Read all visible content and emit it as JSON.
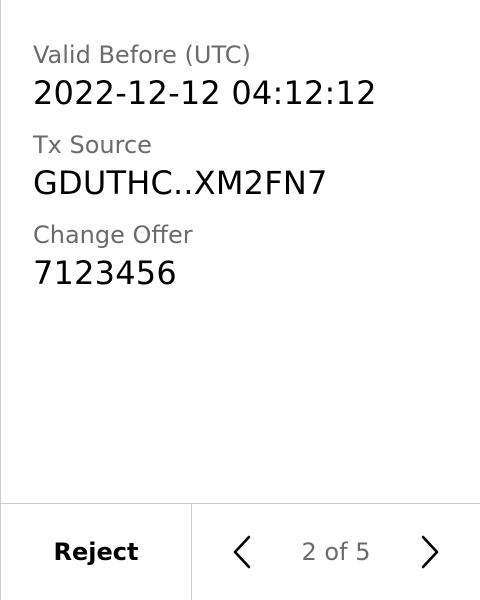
{
  "fields": [
    {
      "label": "Valid Before (UTC)",
      "value": "2022-12-12 04:12:12"
    },
    {
      "label": "Tx Source",
      "value": "GDUTHC..XM2FN7"
    },
    {
      "label": "Change Offer",
      "value": "7123456"
    }
  ],
  "footer": {
    "reject_label": "Reject",
    "page_indicator": "2 of 5",
    "prev_icon": "chevron-left-icon",
    "next_icon": "chevron-right-icon"
  },
  "colors": {
    "label": "#6b6b6b",
    "value": "#000000",
    "divider": "#c9c9c9",
    "background": "#ffffff"
  }
}
